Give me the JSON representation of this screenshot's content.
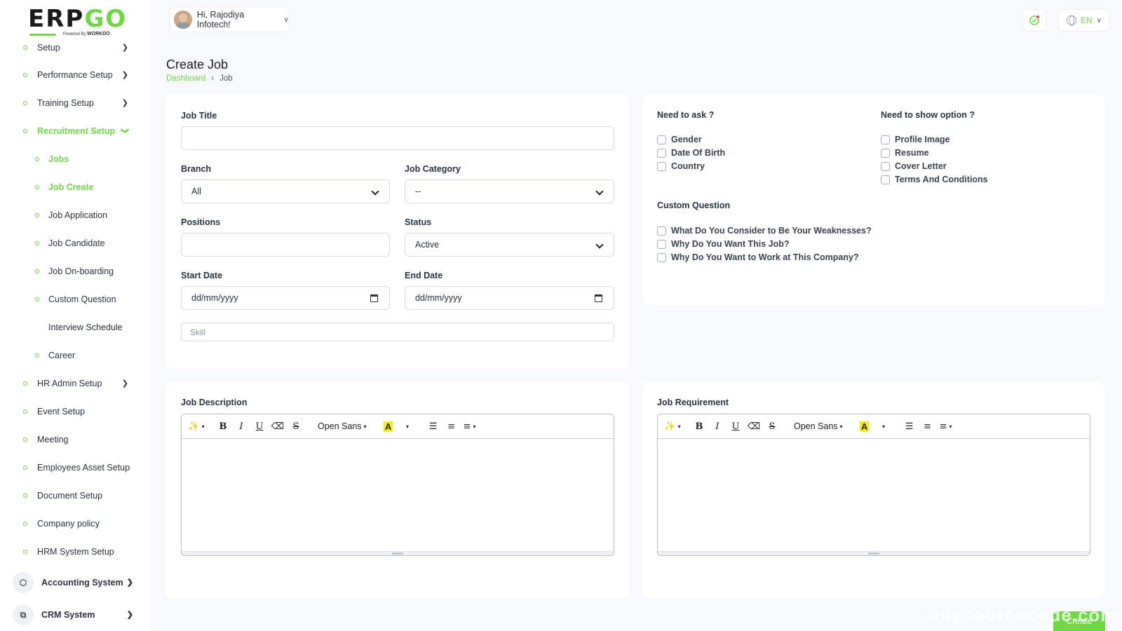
{
  "logo": {
    "erp": "ERP",
    "go": "GO",
    "powered_by": "Powered By",
    "brand": "WORKDO"
  },
  "sidebar": {
    "items": [
      {
        "label": "Setup"
      },
      {
        "label": "Performance Setup"
      },
      {
        "label": "Training Setup"
      },
      {
        "label": "Recruitment Setup"
      },
      {
        "label": "Jobs"
      },
      {
        "label": "Job Create"
      },
      {
        "label": "Job Application"
      },
      {
        "label": "Job Candidate"
      },
      {
        "label": "Job On-boarding"
      },
      {
        "label": "Custom Question"
      },
      {
        "label": "Interview Schedule"
      },
      {
        "label": "Career"
      },
      {
        "label": "HR Admin Setup"
      },
      {
        "label": "Event Setup"
      },
      {
        "label": "Meeting"
      },
      {
        "label": "Employees Asset Setup"
      },
      {
        "label": "Document Setup"
      },
      {
        "label": "Company policy"
      },
      {
        "label": "HRM System Setup"
      },
      {
        "label": "Accounting System"
      },
      {
        "label": "CRM System"
      }
    ]
  },
  "header": {
    "greeting": "Hi, Rajodiya Infotech!",
    "language": "EN"
  },
  "page": {
    "title": "Create Job",
    "breadcrumb": {
      "home": "Dashboard",
      "current": "Job"
    }
  },
  "form": {
    "job_title_label": "Job Title",
    "job_title_value": "",
    "branch_label": "Branch",
    "branch_value": "All",
    "category_label": "Job Category",
    "category_value": "--",
    "positions_label": "Positions",
    "positions_value": "",
    "status_label": "Status",
    "status_value": "Active",
    "start_label": "Start Date",
    "start_placeholder": "dd/mm/yyyy",
    "end_label": "End Date",
    "end_placeholder": "dd/mm/yyyy",
    "skill_placeholder": "Skill"
  },
  "options": {
    "ask_title": "Need to ask ?",
    "ask_items": [
      "Gender",
      "Date Of Birth",
      "Country"
    ],
    "show_title": "Need to show option ?",
    "show_items": [
      "Profile Image",
      "Resume",
      "Cover Letter",
      "Terms And Conditions"
    ],
    "custom_title": "Custom Question",
    "custom_items": [
      "What Do You Consider to Be Your Weaknesses?",
      "Why Do You Want This Job?",
      "Why Do You Want to Work at This Company?"
    ]
  },
  "editors": {
    "description_label": "Job Description",
    "requirement_label": "Job Requirement",
    "font_name": "Open Sans",
    "bold": "B",
    "italic": "I",
    "underline": "U",
    "strike": "S",
    "highlight": "A"
  },
  "actions": {
    "create_label": "Create"
  },
  "watermark": "anysourcecode.com",
  "colors": {
    "accent": "#6fd943",
    "background": "#f8f9fd",
    "text": "#293240"
  }
}
